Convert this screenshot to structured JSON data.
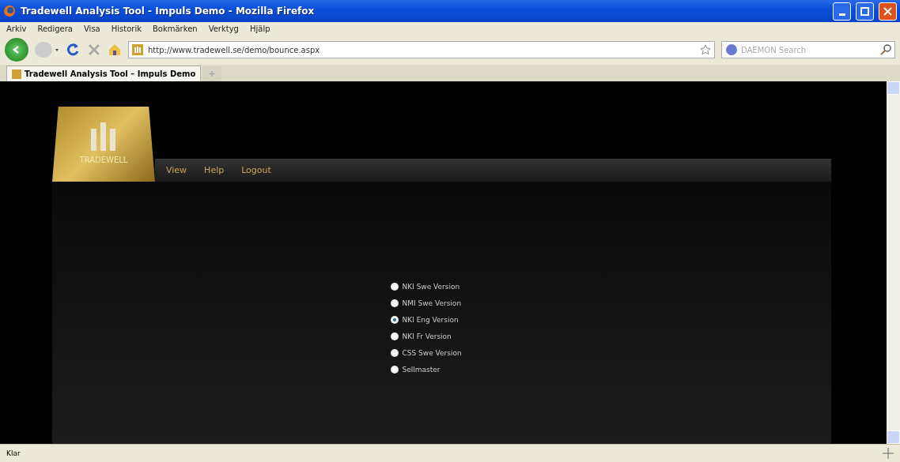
{
  "window": {
    "title": "Tradewell Analysis Tool - Impuls Demo - Mozilla Firefox"
  },
  "menu": [
    "Arkiv",
    "Redigera",
    "Visa",
    "Historik",
    "Bokmärken",
    "Verktyg",
    "Hjälp"
  ],
  "address": {
    "value": "http://www.tradewell.se/demo/bounce.aspx"
  },
  "search": {
    "placeholder": "DAEMON Search"
  },
  "tabs": [
    {
      "label": "Tradewell Analysis Tool – Impuls Demo",
      "selected": true
    }
  ],
  "logo": {
    "text": "TRADEWELL"
  },
  "nav": [
    "View",
    "Help",
    "Logout"
  ],
  "options": [
    {
      "label": "NKI Swe Version",
      "selected": false
    },
    {
      "label": "NMI Swe Version",
      "selected": false
    },
    {
      "label": "NKI Eng Version",
      "selected": true
    },
    {
      "label": "NKI Fr Version",
      "selected": false
    },
    {
      "label": "CSS Swe Version",
      "selected": false
    },
    {
      "label": "Sellmaster",
      "selected": false
    }
  ],
  "status_bar": {
    "text": "Klar"
  }
}
